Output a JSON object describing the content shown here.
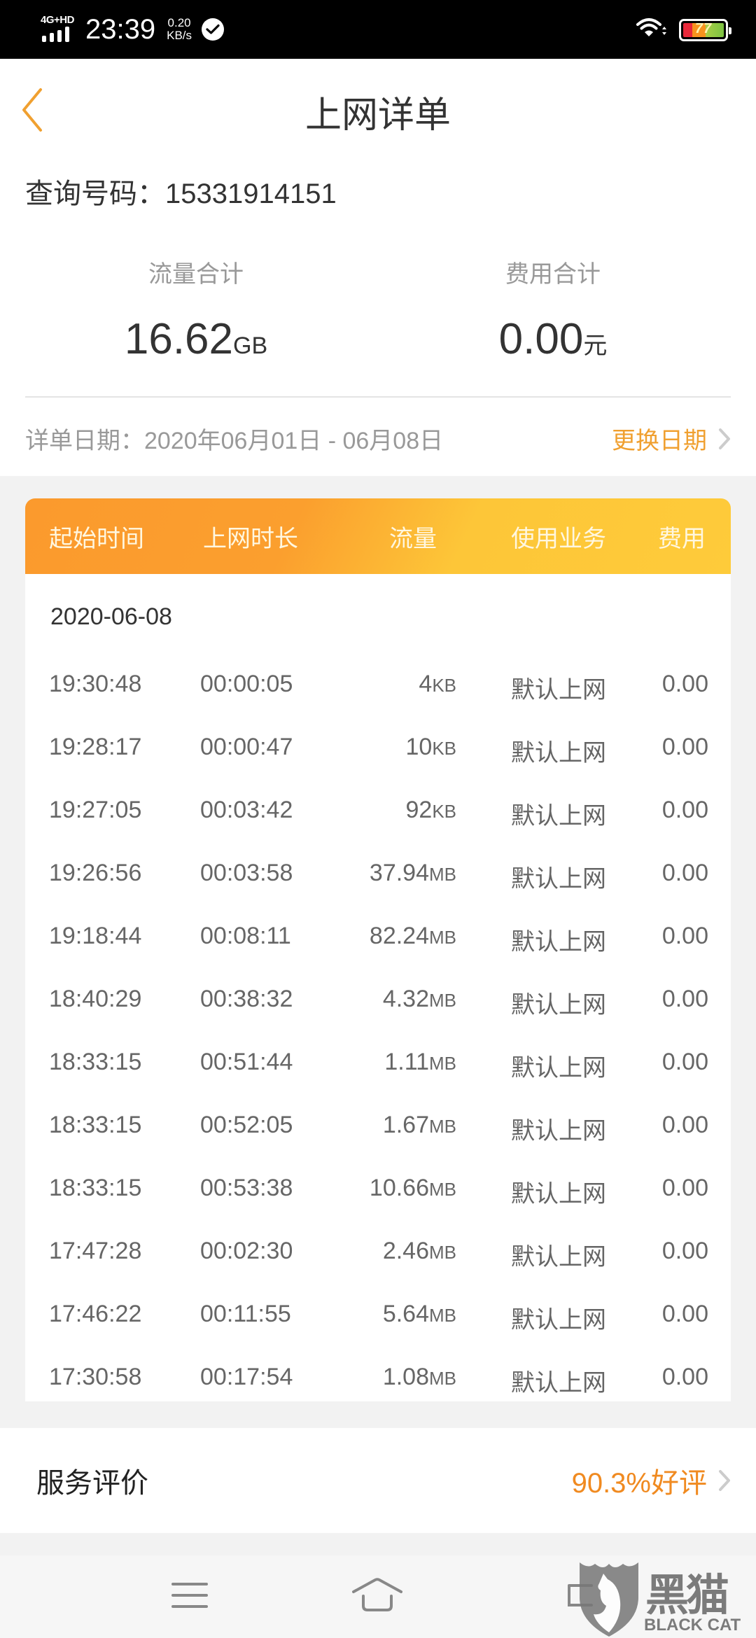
{
  "status_bar": {
    "network_type": "4G+HD",
    "time": "23:39",
    "speed_value": "0.20",
    "speed_unit": "KB/s",
    "battery_level": "77",
    "icons": [
      "signal-bars-icon",
      "check-circle-icon",
      "wifi-icon",
      "battery-icon"
    ]
  },
  "header": {
    "title": "上网详单",
    "back_icon": "chevron-left-icon"
  },
  "query": {
    "label": "查询号码：",
    "number": "15331914151"
  },
  "summary": {
    "traffic": {
      "label": "流量合计",
      "value": "16.62",
      "unit": "GB"
    },
    "fee": {
      "label": "费用合计",
      "value": "0.00",
      "unit": "元"
    }
  },
  "date_range": {
    "label": "详单日期：2020年06月01日 - 06月08日",
    "change_label": "更换日期"
  },
  "table": {
    "columns": [
      "起始时间",
      "上网时长",
      "流量",
      "使用业务",
      "费用"
    ],
    "group_date": "2020-06-08",
    "rows": [
      {
        "start": "19:30:48",
        "duration": "00:00:05",
        "flow": "4",
        "unit": "KB",
        "service": "默认上网",
        "fee": "0.00"
      },
      {
        "start": "19:28:17",
        "duration": "00:00:47",
        "flow": "10",
        "unit": "KB",
        "service": "默认上网",
        "fee": "0.00"
      },
      {
        "start": "19:27:05",
        "duration": "00:03:42",
        "flow": "92",
        "unit": "KB",
        "service": "默认上网",
        "fee": "0.00"
      },
      {
        "start": "19:26:56",
        "duration": "00:03:58",
        "flow": "37.94",
        "unit": "MB",
        "service": "默认上网",
        "fee": "0.00"
      },
      {
        "start": "19:18:44",
        "duration": "00:08:11",
        "flow": "82.24",
        "unit": "MB",
        "service": "默认上网",
        "fee": "0.00"
      },
      {
        "start": "18:40:29",
        "duration": "00:38:32",
        "flow": "4.32",
        "unit": "MB",
        "service": "默认上网",
        "fee": "0.00"
      },
      {
        "start": "18:33:15",
        "duration": "00:51:44",
        "flow": "1.11",
        "unit": "MB",
        "service": "默认上网",
        "fee": "0.00"
      },
      {
        "start": "18:33:15",
        "duration": "00:52:05",
        "flow": "1.67",
        "unit": "MB",
        "service": "默认上网",
        "fee": "0.00"
      },
      {
        "start": "18:33:15",
        "duration": "00:53:38",
        "flow": "10.66",
        "unit": "MB",
        "service": "默认上网",
        "fee": "0.00"
      },
      {
        "start": "17:47:28",
        "duration": "00:02:30",
        "flow": "2.46",
        "unit": "MB",
        "service": "默认上网",
        "fee": "0.00"
      },
      {
        "start": "17:46:22",
        "duration": "00:11:55",
        "flow": "5.64",
        "unit": "MB",
        "service": "默认上网",
        "fee": "0.00"
      },
      {
        "start": "17:30:58",
        "duration": "00:17:54",
        "flow": "1.08",
        "unit": "MB",
        "service": "默认上网",
        "fee": "0.00"
      }
    ]
  },
  "rating": {
    "label": "服务评价",
    "value": "90.3%好评"
  },
  "nav": {
    "icons": [
      "menu-icon",
      "home-icon",
      "back-nav-icon"
    ]
  },
  "watermark": {
    "text": "黑猫",
    "sub": "BLACK CAT"
  },
  "colors": {
    "accent": "#f0a030",
    "header_gradient_start": "#fb9a2d",
    "header_gradient_end": "#fecb3a",
    "rating_value": "#f08a20"
  }
}
